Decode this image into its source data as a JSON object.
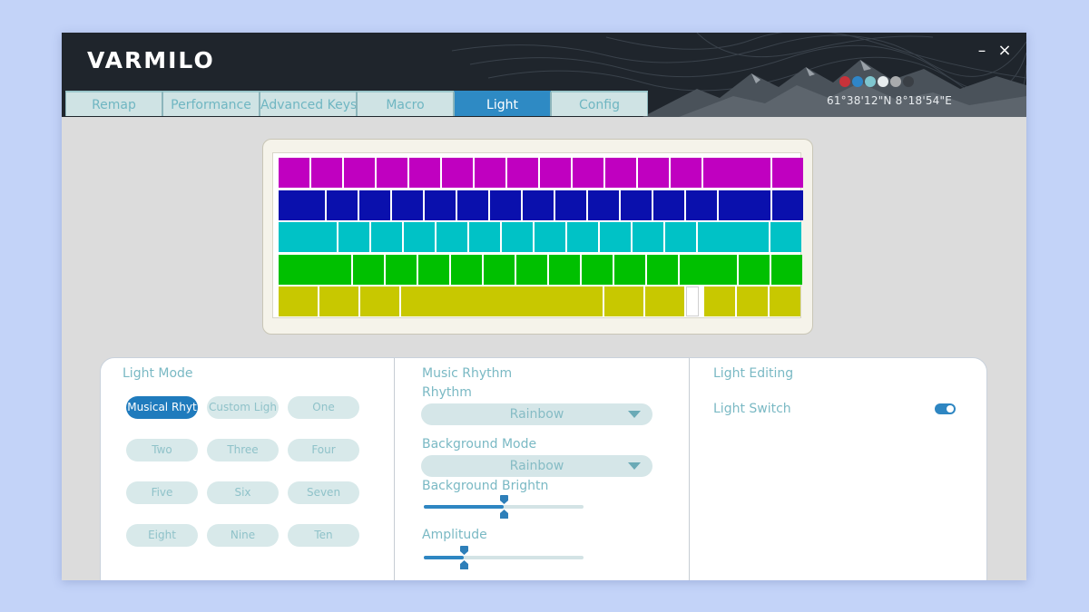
{
  "app": {
    "logo": "VARMILO",
    "minimize_glyph": "–",
    "close_glyph": "×"
  },
  "tabs": [
    {
      "label": "Remap"
    },
    {
      "label": "Performance"
    },
    {
      "label": "Advanced Keys"
    },
    {
      "label": "Macro"
    },
    {
      "label": "Light",
      "active": true
    },
    {
      "label": "Config"
    }
  ],
  "header": {
    "coordinates": "61°38'12\"N 8°18'54\"E",
    "swatch_colors": [
      "#c8323a",
      "#2f86c8",
      "#7fc6cf",
      "#e7ecee",
      "#a9abad",
      "#3a3f45"
    ]
  },
  "keyboard": {
    "row_colors": [
      "#c000c0",
      "#0a10ad",
      "#00c2c6",
      "#00c000",
      "#c8c800"
    ]
  },
  "light_mode": {
    "title": "Light Mode",
    "modes": [
      {
        "label": "Musical Rhyt",
        "active": true
      },
      {
        "label": "Custom Ligh"
      },
      {
        "label": "One"
      },
      {
        "label": "Two"
      },
      {
        "label": "Three"
      },
      {
        "label": "Four"
      },
      {
        "label": "Five"
      },
      {
        "label": "Six"
      },
      {
        "label": "Seven"
      },
      {
        "label": "Eight"
      },
      {
        "label": "Nine"
      },
      {
        "label": "Ten"
      }
    ]
  },
  "music_rhythm": {
    "title": "Music Rhythm",
    "rhythm_label": "Rhythm",
    "rhythm_value": "Rainbow",
    "background_mode_label": "Background Mode",
    "background_mode_value": "Rainbow",
    "background_brightness_label": "Background Brightn",
    "background_brightness_level": 0.5,
    "amplitude_label": "Amplitude",
    "amplitude_level": 0.25
  },
  "light_editing": {
    "title": "Light Editing",
    "switch_label": "Light Switch",
    "switch_on": true
  }
}
